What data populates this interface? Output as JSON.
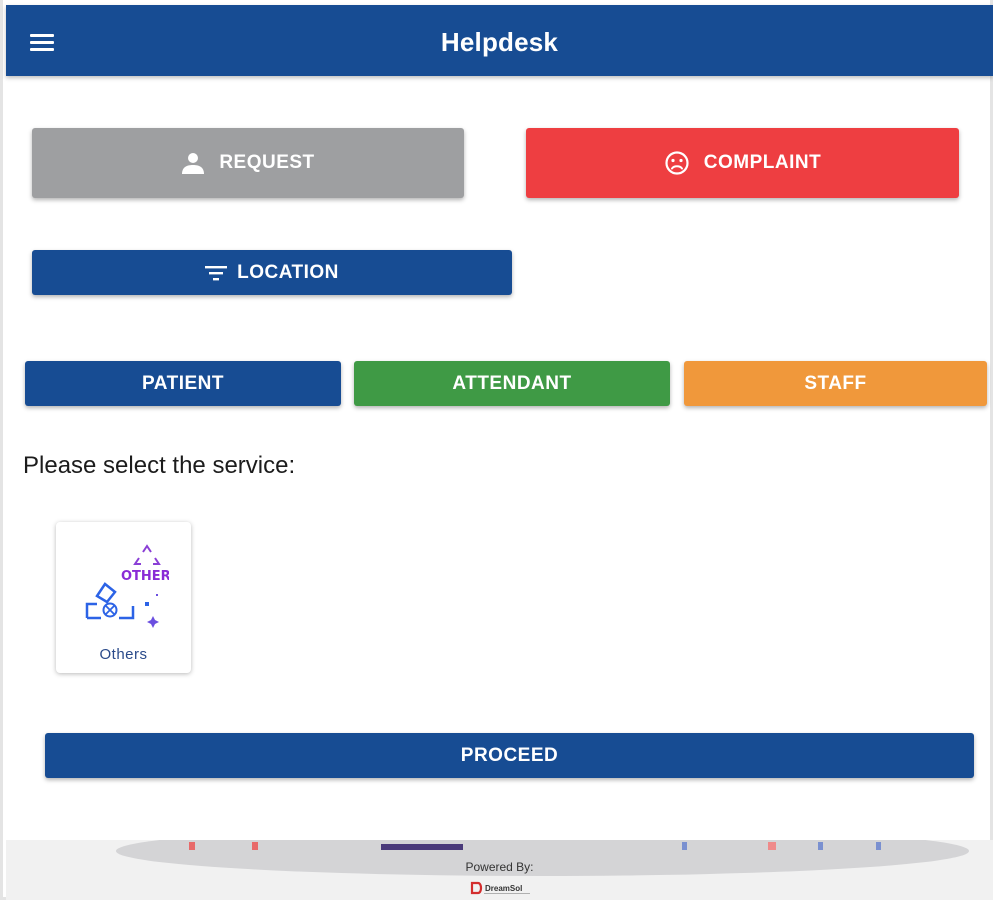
{
  "appbar": {
    "title": "Helpdesk",
    "menu_icon": "hamburger-menu-icon"
  },
  "type_buttons": {
    "request": {
      "label": "REQUEST",
      "icon": "person-icon",
      "color": "#9e9fa1"
    },
    "complaint": {
      "label": "COMPLAINT",
      "icon": "sad-face-icon",
      "color": "#ee3e41"
    }
  },
  "location_button": {
    "label": "LOCATION",
    "icon": "filter-icon",
    "color": "#174c93"
  },
  "user_types": {
    "patient": {
      "label": "PATIENT",
      "color": "#174c93"
    },
    "attendant": {
      "label": "ATTENDANT",
      "color": "#3f9a45"
    },
    "staff": {
      "label": "STAFF",
      "color": "#f0983b"
    }
  },
  "service_prompt": "Please select the service:",
  "services": [
    {
      "label": "Others",
      "icon": "other-recycle-icon",
      "icon_text": "OTHER"
    }
  ],
  "proceed_button": {
    "label": "PROCEED",
    "color": "#174c93"
  },
  "footer": {
    "powered_by": "Powered By:",
    "logo_text": "DreamSol"
  }
}
